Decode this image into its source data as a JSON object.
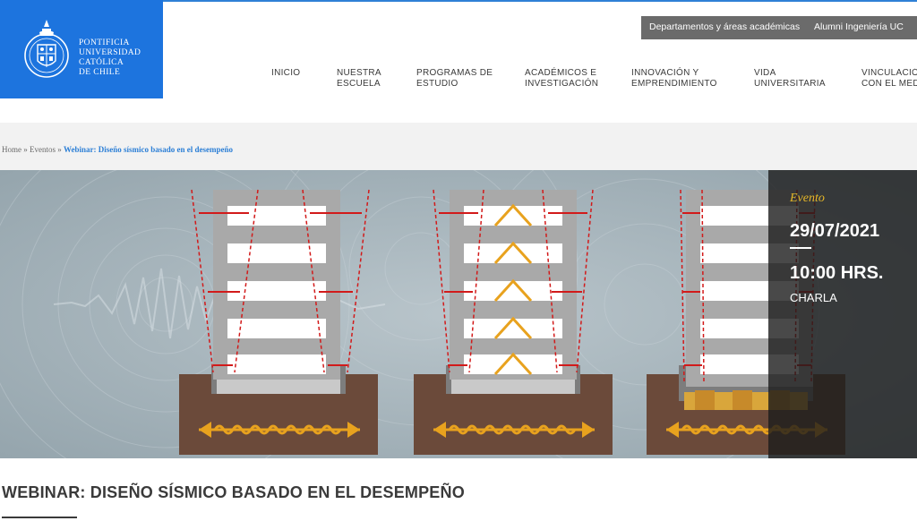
{
  "header": {
    "logo_lines": [
      "PONTIFICIA",
      "UNIVERSIDAD",
      "CATÓLICA",
      "DE CHILE"
    ],
    "utility_links": [
      "Departamentos y áreas académicas",
      "Alumni Ingeniería UC"
    ],
    "nav": [
      {
        "line1": "INICIO",
        "line2": ""
      },
      {
        "line1": "NUESTRA",
        "line2": "ESCUELA"
      },
      {
        "line1": "PROGRAMAS DE",
        "line2": "ESTUDIO"
      },
      {
        "line1": "ACADÉMICOS E",
        "line2": "INVESTIGACIÓN"
      },
      {
        "line1": "INNOVACIÓN Y",
        "line2": "EMPRENDIMIENTO"
      },
      {
        "line1": "VIDA",
        "line2": "UNIVERSITARIA"
      },
      {
        "line1": "VINCULACIÓN",
        "line2": "CON EL MEDIO"
      }
    ]
  },
  "breadcrumb": {
    "home": "Home",
    "sep": "»",
    "section": "Eventos",
    "current": "Webinar: Diseño sísmico basado en el desempeño"
  },
  "event": {
    "label": "Evento",
    "date": "29/07/2021",
    "time": "10:00 HRS.",
    "type": "CHARLA"
  },
  "page": {
    "title": "WEBINAR: DISEÑO SÍSMICO BASADO EN EL DESEMPEÑO"
  },
  "colors": {
    "brand_blue": "#1d74de",
    "accent_gold": "#e8b828",
    "link_blue": "#2c7fd6"
  }
}
